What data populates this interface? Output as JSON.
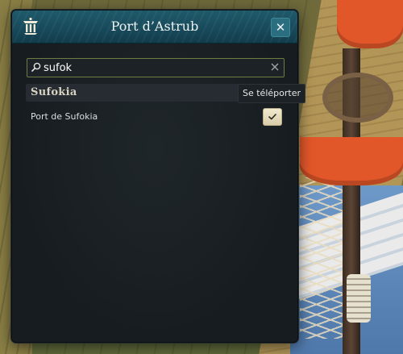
{
  "dialog": {
    "title": "Port d’Astrub",
    "close_symbol": "✕",
    "icon": "zaap-portal-icon"
  },
  "search": {
    "value": "sufok",
    "placeholder": "",
    "icon": "search-icon",
    "clear_icon": "clear-icon"
  },
  "results": [
    {
      "group": "Sufokia",
      "items": [
        {
          "label": "Port de Sufokia",
          "action_icon": "checkmark-icon"
        }
      ]
    }
  ],
  "tooltip": {
    "text": "Se téléporter"
  },
  "colors": {
    "title_bar": "#17495a",
    "panel_bg": "#161b1f",
    "search_border": "#6f7b45",
    "teleport_button": "#e6dcbc"
  }
}
